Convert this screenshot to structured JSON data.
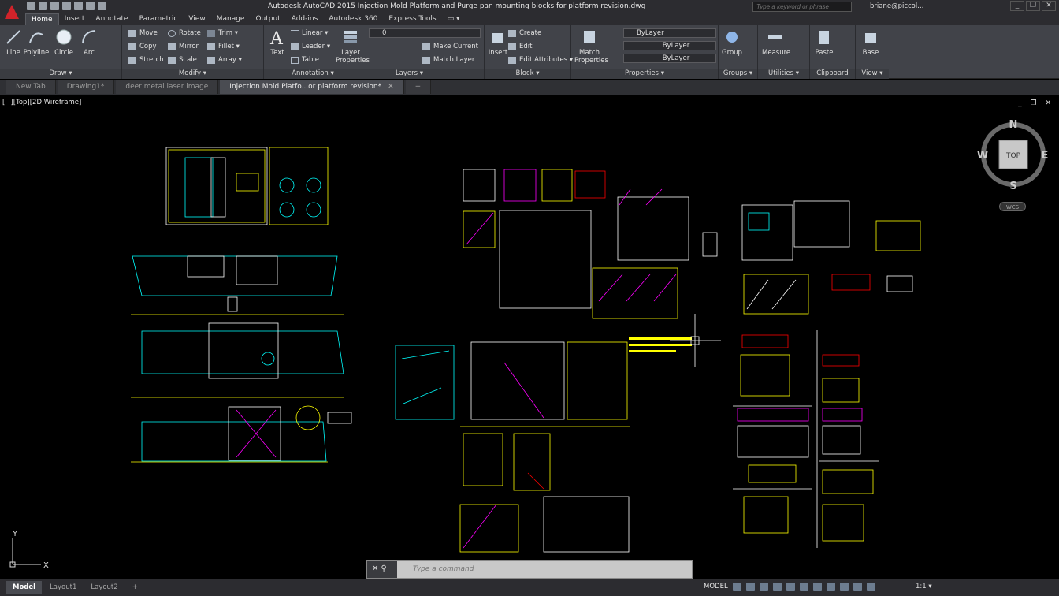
{
  "window": {
    "title": "Autodesk AutoCAD 2015    Injection Mold Platform and Purge pan mounting blocks for platform revision.dwg",
    "search_placeholder": "Type a keyword or phrase",
    "user": "briane@piccol...",
    "controls": [
      "_",
      "❐",
      "✕"
    ]
  },
  "ribbon_tabs": [
    "Home",
    "Insert",
    "Annotate",
    "Parametric",
    "View",
    "Manage",
    "Output",
    "Add-ins",
    "Autodesk 360",
    "Express Tools",
    "▭ ▾"
  ],
  "panels": {
    "draw": {
      "title": "Draw ▾",
      "line": "Line",
      "polyline": "Polyline",
      "circle": "Circle",
      "arc": "Arc"
    },
    "modify": {
      "title": "Modify ▾",
      "move": "Move",
      "rotate": "Rotate",
      "trim": "Trim ▾",
      "copy": "Copy",
      "mirror": "Mirror",
      "fillet": "Fillet ▾",
      "stretch": "Stretch",
      "scale": "Scale",
      "array": "Array ▾"
    },
    "annotation": {
      "title": "Annotation ▾",
      "text": "Text",
      "linear": "Linear ▾",
      "leader": "Leader ▾",
      "table": "Table"
    },
    "layers": {
      "title": "Layers ▾",
      "layer_properties": "Layer Properties",
      "layer_value": "0",
      "make_current": "Make Current",
      "match_layer": "Match Layer"
    },
    "block": {
      "title": "Block ▾",
      "insert": "Insert",
      "create": "Create",
      "edit": "Edit",
      "edit_attributes": "Edit Attributes ▾"
    },
    "properties": {
      "title": "Properties ▾",
      "match_properties": "Match Properties",
      "color": "ByLayer",
      "linetype": "ByLayer",
      "lineweight": "ByLayer"
    },
    "groups": {
      "title": "Groups ▾",
      "group": "Group"
    },
    "utilities": {
      "title": "Utilities ▾",
      "measure": "Measure"
    },
    "clipboard": {
      "title": "Clipboard",
      "paste": "Paste"
    },
    "view": {
      "title": "View ▾",
      "base": "Base"
    }
  },
  "doc_tabs": [
    {
      "label": "New Tab"
    },
    {
      "label": "Drawing1*"
    },
    {
      "label": "deer metal laser image"
    },
    {
      "label": "Injection Mold Platfo...or platform revision*"
    }
  ],
  "doc_tab_close": "✕",
  "doc_tab_add": "+",
  "viewport": {
    "label": "[−][Top][2D Wireframe]",
    "controls": "_ ❐ ✕"
  },
  "viewcube": {
    "n": "N",
    "s": "S",
    "e": "E",
    "w": "W",
    "face": "TOP",
    "wcs": "WCS"
  },
  "ucs": {
    "x": "X",
    "y": "Y"
  },
  "command": {
    "placeholder": "Type a command",
    "buttons": "✕ ⚲"
  },
  "layout_tabs": [
    "Model",
    "Layout1",
    "Layout2",
    "+"
  ],
  "status": {
    "model": "MODEL",
    "scale": "1:1 ▾"
  }
}
